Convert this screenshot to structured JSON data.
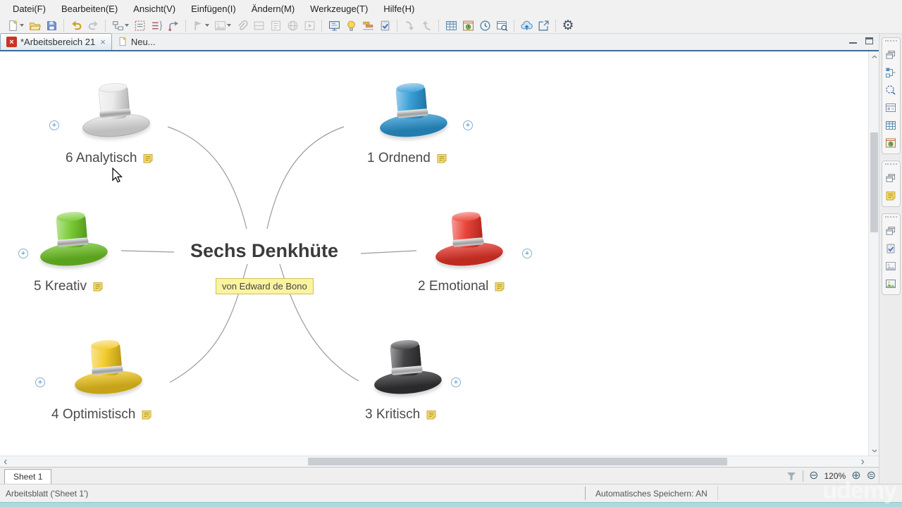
{
  "menu": {
    "items": [
      "Datei(F)",
      "Bearbeiten(E)",
      "Ansicht(V)",
      "Einfügen(I)",
      "Ändern(M)",
      "Werkzeuge(T)",
      "Hilfe(H)"
    ]
  },
  "toolbar": {
    "groups": [
      [
        "new-document",
        "open-folder",
        "save"
      ],
      [
        "undo",
        "redo"
      ],
      [
        "insert-topic",
        "insert-outline",
        "numbered-list",
        "relationship"
      ],
      [
        "flag-marker",
        "insert-image",
        "attachment",
        "split-layout",
        "insert-notes",
        "hyperlink",
        "slideshow"
      ],
      [
        "presentation",
        "idea-bulb",
        "gantt-chart",
        "task-info"
      ],
      [
        "drill-down",
        "drill-up"
      ],
      [
        "insert-table",
        "status-chart",
        "timer",
        "preview-window"
      ],
      [
        "cloud-upload",
        "share-export"
      ],
      [
        "settings-gear"
      ]
    ]
  },
  "tabbar": {
    "tabs": [
      {
        "label": "*Arbeitsbereich 21",
        "active": true,
        "closable": true
      },
      {
        "label": "Neu...",
        "active": false
      }
    ]
  },
  "sidebar": {
    "panels": [
      {
        "icons": [
          "window-panels",
          "structure-diagram",
          "zoom-select",
          "style-gallery",
          "table-view",
          "chart-view"
        ]
      },
      {
        "icons": [
          "window-panels",
          "notes-view"
        ]
      },
      {
        "icons": [
          "window-panels",
          "task-info",
          "image-gallery",
          "picture-view"
        ]
      }
    ]
  },
  "map": {
    "title": "Sechs Denkhüte",
    "floating_note": {
      "text": "von Edward de Bono",
      "bg": "#faf3a0",
      "border": "#cfc25a"
    },
    "topics": [
      {
        "label": "6 Analytisch",
        "hat_color": "#e9e9e9",
        "position": "top-left"
      },
      {
        "label": "1 Ordnend",
        "hat_color": "#2a97d4",
        "position": "top-right"
      },
      {
        "label": "5 Kreativ",
        "hat_color": "#6fc625",
        "position": "middle-left"
      },
      {
        "label": "2 Emotional",
        "hat_color": "#e83428",
        "position": "middle-right"
      },
      {
        "label": "4 Optimistisch",
        "hat_color": "#f2c71d",
        "position": "bottom-left"
      },
      {
        "label": "3 Kritisch",
        "hat_color": "#333336",
        "position": "bottom-right"
      }
    ]
  },
  "sheetbar": {
    "sheet_tab": "Sheet 1",
    "zoom_level": "120%"
  },
  "statusbar": {
    "left": "Arbeitsblatt ('Sheet 1')",
    "autosave": "Automatisches Speichern: AN"
  },
  "watermark": "udemy",
  "colors": {
    "tab_underline": "#3e6a96",
    "teal_bottom_bar": "#aed9dd",
    "note_sticky": "#f4dc6a",
    "app_logo_red": "#cc3322"
  }
}
